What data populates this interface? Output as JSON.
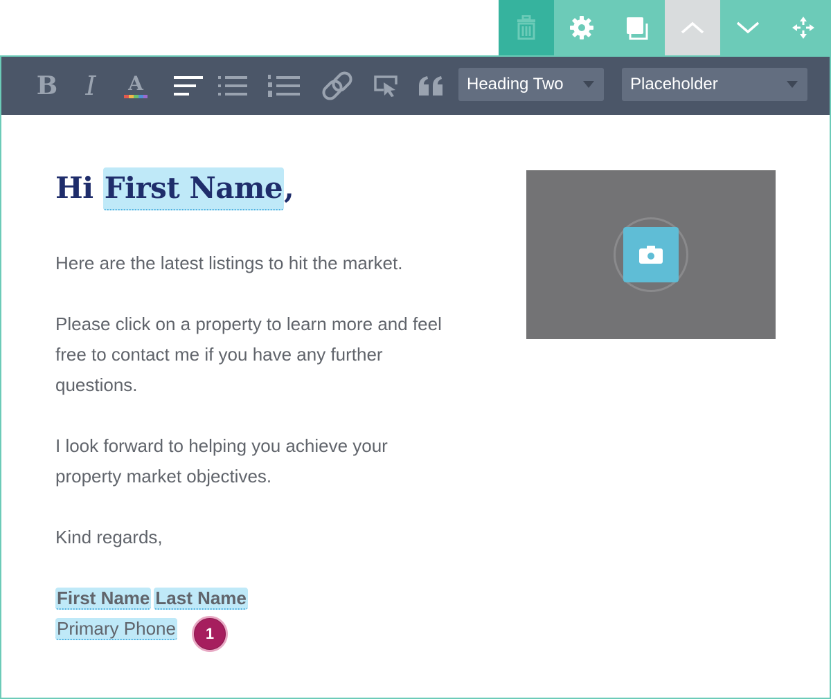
{
  "action_bar": {
    "buttons": [
      {
        "icon": "trash-icon"
      },
      {
        "icon": "gear-icon"
      },
      {
        "icon": "duplicate-icon"
      },
      {
        "icon": "chevron-up-icon"
      },
      {
        "icon": "chevron-down-icon"
      },
      {
        "icon": "move-arrows-icon"
      }
    ]
  },
  "toolbar": {
    "bold": "B",
    "italic": "I",
    "text_color": "A",
    "heading_select": {
      "value": "Heading Two"
    },
    "placeholder_select": {
      "value": "Placeholder"
    }
  },
  "content": {
    "greeting_prefix": "Hi ",
    "greeting_merge": "First Name",
    "greeting_suffix": ",",
    "paragraph_1": "Here are the latest listings to hit the market.",
    "paragraph_2": "Please click on a property to learn more and feel free to contact me if you have any further questions.",
    "paragraph_3": "I look forward to helping you achieve your property market objectives.",
    "paragraph_4": "Kind regards,",
    "signature": {
      "first_name": "First Name",
      "last_name": "Last Name",
      "phone": "Primary Phone"
    },
    "step_badge": "1",
    "image_placeholder": {
      "icon": "camera-icon"
    }
  },
  "colors": {
    "accent": "#6ccbb8",
    "accent_dark": "#36b39e",
    "toolbar_bg": "#4b5668",
    "heading": "#1f2d6b",
    "merge_highlight": "#bfe9f8",
    "badge": "#a61e5e"
  }
}
